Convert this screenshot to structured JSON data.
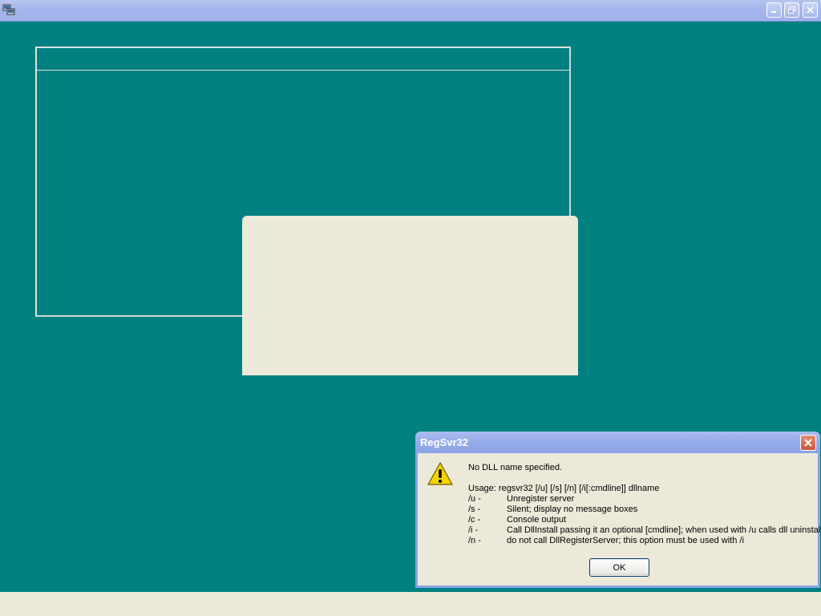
{
  "window": {
    "icons": {
      "app": "regsvr-app-icon",
      "minimize": "minimize-icon",
      "restore": "restore-icon",
      "close": "close-icon"
    }
  },
  "dialog": {
    "title": "RegSvr32",
    "icon": "warning-icon",
    "message": "No DLL name specified.",
    "usage": "Usage: regsvr32 [/u] [/s] [/n] [/i[:cmdline]] dllname",
    "options": [
      {
        "key": "/u -",
        "desc": "Unregister server"
      },
      {
        "key": "/s -",
        "desc": "Silent; display no message boxes"
      },
      {
        "key": "/c -",
        "desc": "Console output"
      },
      {
        "key": "/i -",
        "desc": "Call DllInstall passing it an optional [cmdline]; when used with /u calls dll uninstall"
      },
      {
        "key": "/n -",
        "desc": "do not call DllRegisterServer; this option must be used with /i"
      }
    ],
    "ok_label": "OK"
  },
  "colors": {
    "desktop": "#008080",
    "panel": "#ece9d8",
    "titlebar": "#8aa3e6"
  }
}
